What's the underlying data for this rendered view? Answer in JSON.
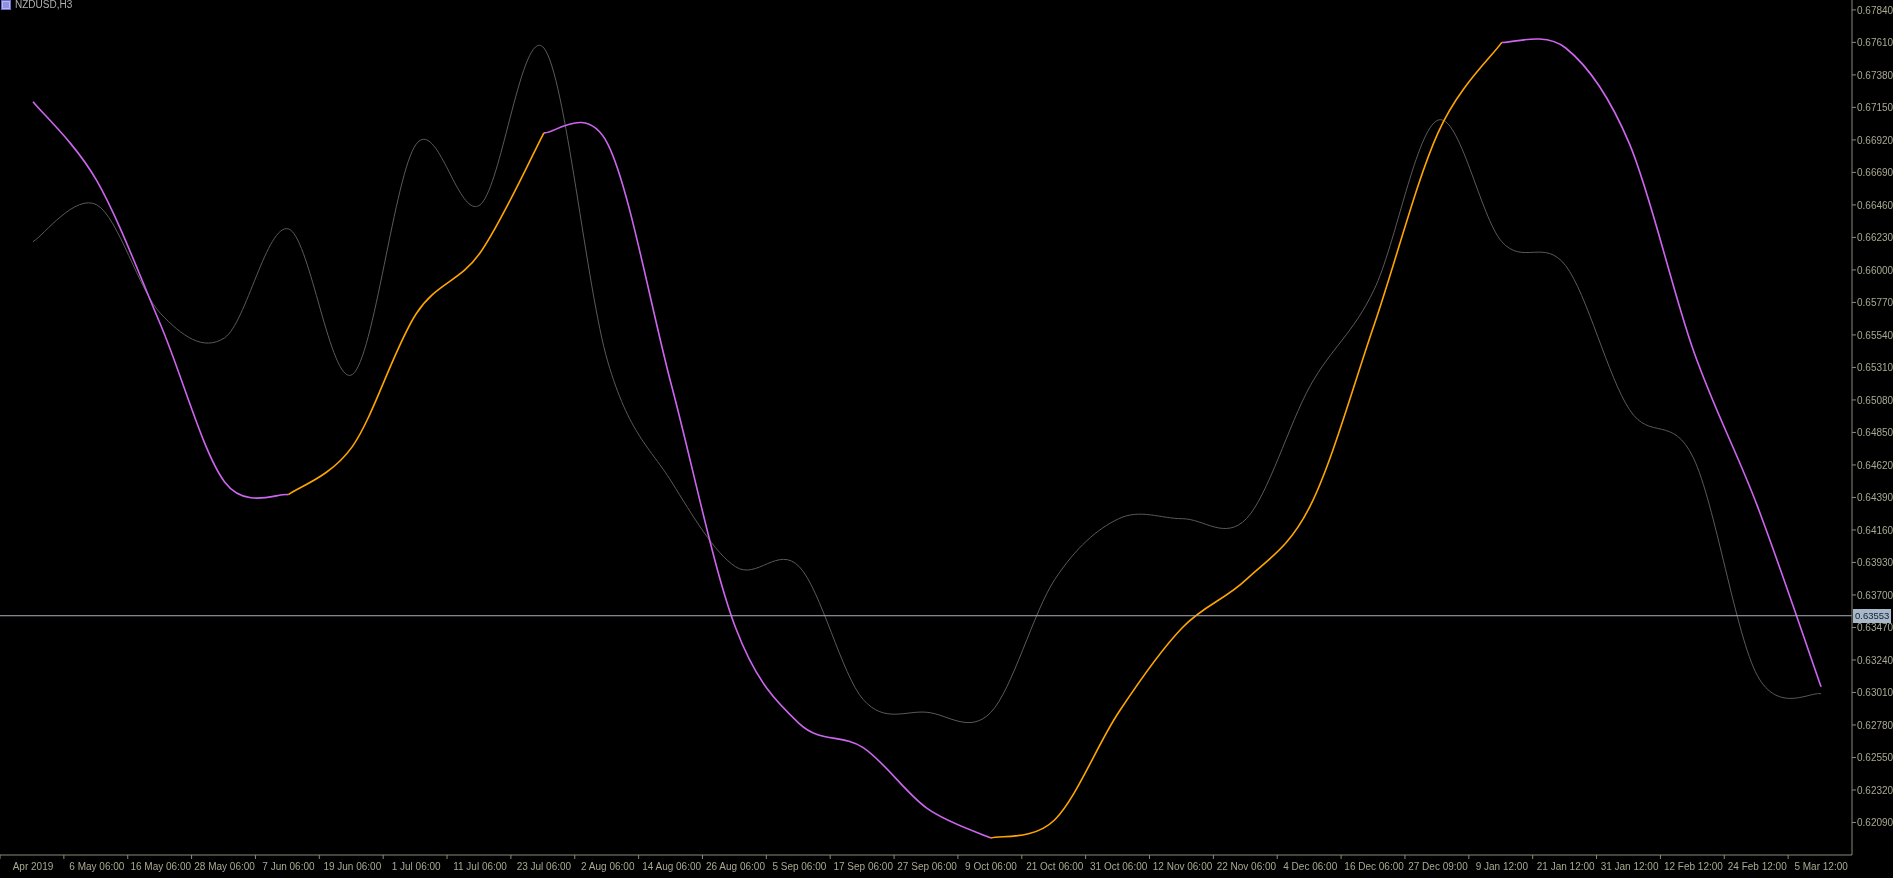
{
  "window": {
    "title": "NZDUSD,H3"
  },
  "chart_data": {
    "type": "line",
    "categories": [
      "Apr 2019",
      "6 May 06:00",
      "16 May 06:00",
      "28 May 06:00",
      "7 Jun 06:00",
      "19 Jun 06:00",
      "1 Jul 06:00",
      "11 Jul 06:00",
      "23 Jul 06:00",
      "2 Aug 06:00",
      "14 Aug 06:00",
      "26 Aug 06:00",
      "5 Sep 06:00",
      "17 Sep 06:00",
      "27 Sep 06:00",
      "9 Oct 06:00",
      "21 Oct 06:00",
      "31 Oct 06:00",
      "12 Nov 06:00",
      "22 Nov 06:00",
      "4 Dec 06:00",
      "16 Dec 06:00",
      "27 Dec 09:00",
      "9 Jan 12:00",
      "21 Jan 12:00",
      "31 Jan 12:00",
      "12 Feb 12:00",
      "24 Feb 12:00",
      "5 Mar 12:00"
    ],
    "series": [
      {
        "color": "#5a5a5a",
        "values": [
          0.662,
          0.6646,
          0.6569,
          0.6552,
          0.6629,
          0.6526,
          0.6689,
          0.6646,
          0.6757,
          0.6535,
          0.645,
          0.639,
          0.639,
          0.6296,
          0.6287,
          0.6287,
          0.6381,
          0.6424,
          0.6424,
          0.6424,
          0.6518,
          0.6586,
          0.6706,
          0.662,
          0.6603,
          0.6501,
          0.6467,
          0.6313,
          0.63
        ]
      },
      {
        "color": "#cc66ee",
        "values": [
          0.6719,
          0.6663,
          0.6561,
          0.645,
          0.6441,
          null,
          null,
          null,
          0.6697,
          0.6689,
          0.6518,
          0.6347,
          0.6279,
          0.6262,
          0.6219,
          0.6198,
          null,
          null,
          null,
          null,
          null,
          null,
          null,
          0.6761,
          0.6757,
          0.6689,
          0.6543,
          0.6433,
          0.6305
        ]
      },
      {
        "color": "#ffa500",
        "values": [
          null,
          null,
          null,
          null,
          0.6441,
          0.6475,
          0.6569,
          0.6612,
          0.6697,
          null,
          null,
          null,
          null,
          null,
          null,
          0.6198,
          0.6211,
          0.6287,
          0.6347,
          0.6381,
          0.6433,
          0.6561,
          0.6697,
          0.6761,
          null,
          null,
          null,
          null,
          null
        ]
      }
    ],
    "ylim": [
      0.6186,
      0.6791
    ],
    "yticks": [
      {
        "value": 0.6784,
        "label": "0.67840"
      },
      {
        "value": 0.6761,
        "label": "0.67610"
      },
      {
        "value": 0.6738,
        "label": "0.67380"
      },
      {
        "value": 0.6715,
        "label": "0.67150"
      },
      {
        "value": 0.6692,
        "label": "0.66920"
      },
      {
        "value": 0.6669,
        "label": "0.66690"
      },
      {
        "value": 0.6646,
        "label": "0.66460"
      },
      {
        "value": 0.6623,
        "label": "0.66230"
      },
      {
        "value": 0.66,
        "label": "0.66000"
      },
      {
        "value": 0.6577,
        "label": "0.65770"
      },
      {
        "value": 0.6554,
        "label": "0.65540"
      },
      {
        "value": 0.6531,
        "label": "0.65310"
      },
      {
        "value": 0.6508,
        "label": "0.65080"
      },
      {
        "value": 0.6485,
        "label": "0.64850"
      },
      {
        "value": 0.6462,
        "label": "0.64620"
      },
      {
        "value": 0.6439,
        "label": "0.64390"
      },
      {
        "value": 0.6416,
        "label": "0.64160"
      },
      {
        "value": 0.6393,
        "label": "0.63930"
      },
      {
        "value": 0.637,
        "label": "0.63700"
      },
      {
        "value": 0.6347,
        "label": "0.63470"
      },
      {
        "value": 0.6324,
        "label": "0.63240"
      },
      {
        "value": 0.6301,
        "label": "0.63010"
      },
      {
        "value": 0.6278,
        "label": "0.62780"
      },
      {
        "value": 0.6255,
        "label": "0.62550"
      },
      {
        "value": 0.6232,
        "label": "0.62320"
      },
      {
        "value": 0.6209,
        "label": "0.62090"
      }
    ],
    "ref_lines": [
      {
        "axis": "y",
        "value": 0.63553,
        "label": "0.63553",
        "color": "#a8b0b8"
      }
    ]
  }
}
